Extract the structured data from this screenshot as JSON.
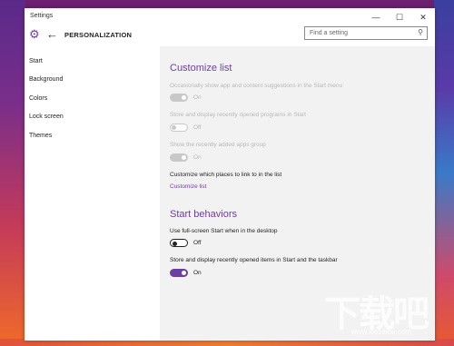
{
  "window": {
    "title": "Settings",
    "controls": {
      "minimize": "—",
      "maximize": "☐",
      "close": "✕"
    }
  },
  "header": {
    "title": "PERSONALIZATION",
    "search_placeholder": "Find a setting",
    "back_glyph": "←",
    "gear_glyph": "⚙",
    "search_glyph": "⚲"
  },
  "sidebar": {
    "items": [
      {
        "label": "Start"
      },
      {
        "label": "Background"
      },
      {
        "label": "Colors"
      },
      {
        "label": "Lock screen"
      },
      {
        "label": "Themes"
      }
    ]
  },
  "main": {
    "customize_list": {
      "heading": "Customize list",
      "settings": [
        {
          "label": "Occasionally show app and content suggestions in the Start menu",
          "state": "On"
        },
        {
          "label": "Store and display recently opened programs in Start",
          "state": "Off"
        },
        {
          "label": "Show the recently added apps group",
          "state": "On"
        }
      ],
      "places_text": "Customize which places to link to in the list",
      "places_link": "Customize list"
    },
    "start_behaviors": {
      "heading": "Start behaviors",
      "settings": [
        {
          "label": "Use full-screen Start when in the desktop",
          "state": "Off"
        },
        {
          "label": "Store and display recently opened items in Start and the taskbar",
          "state": "On"
        }
      ]
    }
  },
  "colors": {
    "accent": "#6b3fa0"
  },
  "watermark": {
    "main": "下载吧",
    "sub": "www.xiazaiba.com"
  }
}
